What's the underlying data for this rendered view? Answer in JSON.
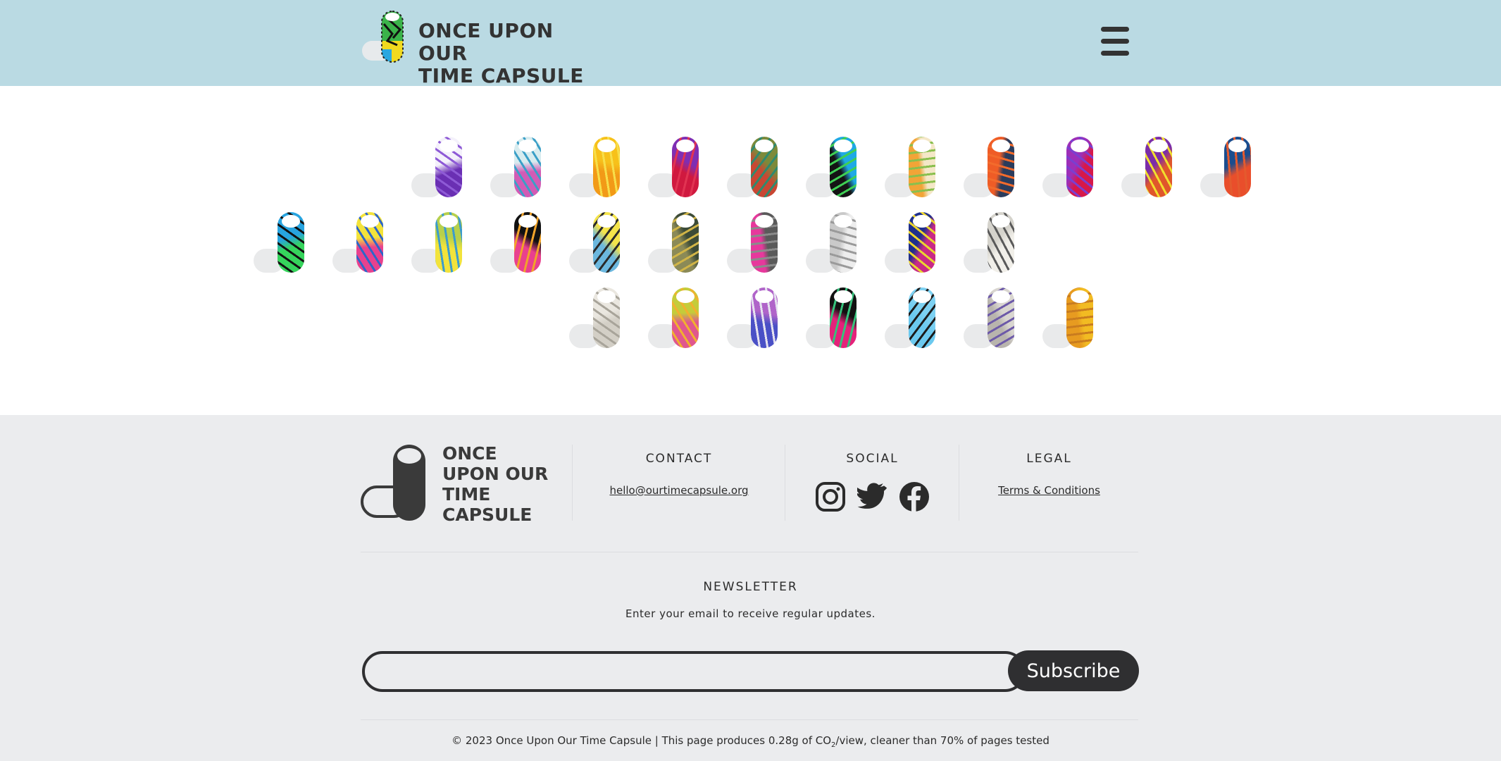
{
  "header": {
    "logo_line1": "ONCE UPON OUR",
    "logo_line2": "TIME CAPSULE",
    "logo_icon": "capsule-logo-icon",
    "menu_icon": "hamburger-menu-icon",
    "background": "#badae3"
  },
  "capsules": {
    "row1": [
      {
        "name": "capsule-purple-stripes",
        "colors": [
          "#f4f1fb",
          "#6a2fb3",
          "#8e5ad6"
        ]
      },
      {
        "name": "capsule-scribble-multicolor",
        "colors": [
          "#d8ecef",
          "#d25bb5",
          "#3a9fc7"
        ]
      },
      {
        "name": "capsule-yellow-orange",
        "colors": [
          "#f7c11a",
          "#f29a17",
          "#f7de4a"
        ]
      },
      {
        "name": "capsule-magenta-red",
        "colors": [
          "#7f2eb3",
          "#d0193f",
          "#e13352"
        ]
      },
      {
        "name": "capsule-brown-green",
        "colors": [
          "#7c8a3a",
          "#c84733",
          "#2f8a6e"
        ]
      },
      {
        "name": "capsule-blue-face",
        "colors": [
          "#1fa9e5",
          "#141414",
          "#3fcf54"
        ]
      },
      {
        "name": "capsule-child-drawing",
        "colors": [
          "#f4e7c7",
          "#f2a437",
          "#8abf4e"
        ]
      },
      {
        "name": "capsule-orange-navy",
        "colors": [
          "#2b3c5c",
          "#ef5c26",
          "#f36b2c"
        ]
      },
      {
        "name": "capsule-pink-purple",
        "colors": [
          "#d7184a",
          "#9d2fb8",
          "#7a3fd0"
        ]
      },
      {
        "name": "capsule-rainbow-yellow",
        "colors": [
          "#e0572b",
          "#7b2da8",
          "#f1df2d"
        ]
      },
      {
        "name": "capsule-orange-blue",
        "colors": [
          "#e94e2b",
          "#1b4d8e",
          "#e45a2e"
        ]
      }
    ],
    "row2": [
      {
        "name": "capsule-green-black",
        "colors": [
          "#27a4e0",
          "#36d45c",
          "#111111"
        ]
      },
      {
        "name": "capsule-rainbow-wedge",
        "colors": [
          "#f3e33a",
          "#e8418e",
          "#2d66c9"
        ]
      },
      {
        "name": "capsule-lime-yellow",
        "colors": [
          "#b7d04b",
          "#f2e33b",
          "#3c9ccc"
        ]
      },
      {
        "name": "capsule-black-neon",
        "colors": [
          "#111111",
          "#e9408e",
          "#f1a32a"
        ]
      },
      {
        "name": "capsule-sky-yellow",
        "colors": [
          "#f4e44a",
          "#6bb7de",
          "#2a2a2a"
        ]
      },
      {
        "name": "capsule-olive-camo",
        "colors": [
          "#3c4b37",
          "#8b8a57",
          "#d0b447"
        ]
      },
      {
        "name": "capsule-grey-pink",
        "colors": [
          "#5a5a5a",
          "#e7389c",
          "#8b8b8b"
        ]
      },
      {
        "name": "capsule-handwritten-note",
        "colors": [
          "#ededed",
          "#c9c9c9",
          "#9a9a9a"
        ]
      },
      {
        "name": "capsule-magenta-navy",
        "colors": [
          "#c82a86",
          "#1f2f8c",
          "#ecd52e"
        ]
      },
      {
        "name": "capsule-written-letter",
        "colors": [
          "#f1efe9",
          "#d5d3cc",
          "#5a5a5a"
        ]
      }
    ],
    "row3": [
      {
        "name": "capsule-paper-script",
        "colors": [
          "#eae7e0",
          "#d3cfc6",
          "#a8a49a"
        ]
      },
      {
        "name": "capsule-lime-pink",
        "colors": [
          "#c4cc3a",
          "#e0578d",
          "#f1b12e"
        ]
      },
      {
        "name": "capsule-purple-scribble",
        "colors": [
          "#b064c9",
          "#4a50c6",
          "#e5e2ef"
        ]
      },
      {
        "name": "capsule-black-heart",
        "colors": [
          "#121212",
          "#e4227a",
          "#36c17c"
        ]
      },
      {
        "name": "capsule-light-blue",
        "colors": [
          "#7dd1f2",
          "#6bc9ef",
          "#1c1c1c"
        ]
      },
      {
        "name": "capsule-grey-sketch",
        "colors": [
          "#d9d6d0",
          "#b8b4ad",
          "#6d5aa8"
        ]
      },
      {
        "name": "capsule-gold-lines",
        "colors": [
          "#f2bb22",
          "#e79b20",
          "#c97c1f"
        ]
      }
    ]
  },
  "footer": {
    "logo_line1": "ONCE",
    "logo_line2": "UPON OUR",
    "logo_line3": "TIME",
    "logo_line4": "CAPSULE",
    "contact_title": "CONTACT",
    "contact_email": "hello@ourtimecapsule.org",
    "social_title": "SOCIAL",
    "social_icons": [
      "instagram-icon",
      "twitter-icon",
      "facebook-icon"
    ],
    "legal_title": "LEGAL",
    "legal_link": "Terms & Conditions",
    "newsletter_title": "NEWSLETTER",
    "newsletter_desc": "Enter your email to receive regular updates.",
    "email_value": "",
    "subscribe_label": "Subscribe",
    "copyright_before": "© 2023 Once Upon Our Time Capsule | This page produces 0.28g of CO",
    "copyright_sub": "2",
    "copyright_after": "/view, cleaner than 70% of pages tested",
    "background": "#ebecee"
  }
}
